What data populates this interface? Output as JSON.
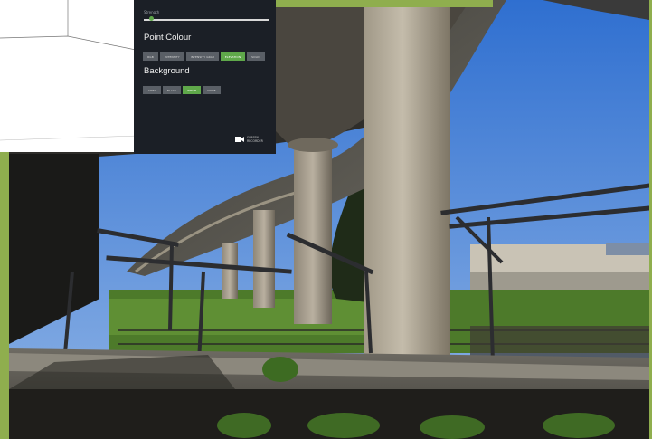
{
  "viewer": {
    "slider_label": "Strength",
    "point_colour_heading": "Point Colour",
    "point_colour_options": [
      {
        "label": "RGB",
        "active": false
      },
      {
        "label": "Intensity",
        "active": false
      },
      {
        "label": "Intensity Grad",
        "active": false
      },
      {
        "label": "Elevation",
        "active": true
      },
      {
        "label": "Solid",
        "active": false
      }
    ],
    "background_heading": "Background",
    "background_options": [
      {
        "label": "Grey",
        "active": false
      },
      {
        "label": "Black",
        "active": false
      },
      {
        "label": "White",
        "active": true
      },
      {
        "label": "None",
        "active": false
      }
    ],
    "slider_value": 0.05,
    "recorder_line1": "SCREEN",
    "recorder_line2": "RECORDER",
    "colors": {
      "panel_bg": "#1b1f26",
      "accent_green": "#5fa84a",
      "border_green": "#8fae4e",
      "sky": "#3f7fd0"
    }
  }
}
